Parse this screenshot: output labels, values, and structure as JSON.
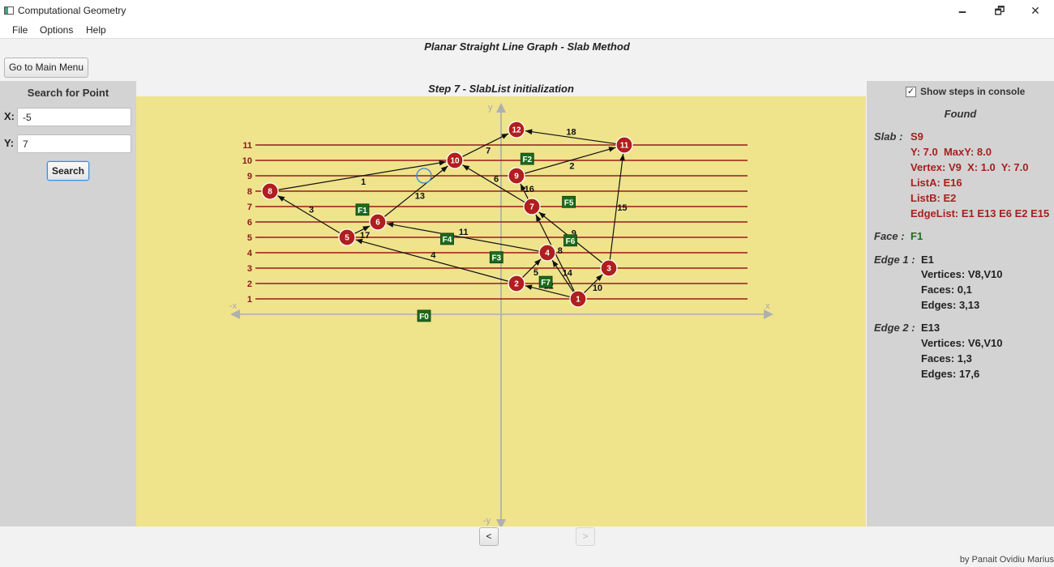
{
  "window": {
    "title": "Computational Geometry",
    "controls": [
      "🗕",
      "🗗",
      "✕"
    ]
  },
  "menu": [
    "File",
    "Options",
    "Help"
  ],
  "main_title": "Planar Straight Line Graph - Slab Method",
  "main_menu_button": "Go to Main Menu",
  "search": {
    "title": "Search for Point",
    "x_label": "X:",
    "x_value": "-5",
    "y_label": "Y:",
    "y_value": "7",
    "button": "Search"
  },
  "step_title": "Step 7 - SlabList initialization",
  "graph": {
    "axis_labels": {
      "x": "x",
      "neg_x": "-x",
      "y": "y",
      "neg_y": "-y"
    },
    "slabs": [
      1,
      2,
      3,
      4,
      5,
      6,
      7,
      8,
      9,
      10,
      11
    ],
    "vertices": [
      {
        "id": "1",
        "x": 5,
        "y": 1
      },
      {
        "id": "2",
        "x": 1,
        "y": 2
      },
      {
        "id": "3",
        "x": 7,
        "y": 3
      },
      {
        "id": "4",
        "x": 3,
        "y": 4
      },
      {
        "id": "5",
        "x": -10,
        "y": 5
      },
      {
        "id": "6",
        "x": -8,
        "y": 6
      },
      {
        "id": "7",
        "x": 2,
        "y": 7
      },
      {
        "id": "8",
        "x": -15,
        "y": 8
      },
      {
        "id": "9",
        "x": 1,
        "y": 9
      },
      {
        "id": "10",
        "x": -3,
        "y": 10
      },
      {
        "id": "11",
        "x": 8,
        "y": 11
      },
      {
        "id": "12",
        "x": 1,
        "y": 12
      }
    ],
    "edges": [
      {
        "label": "1",
        "from": "8",
        "to": "10"
      },
      {
        "label": "2",
        "from": "9",
        "to": "11"
      },
      {
        "label": "3",
        "from": "5",
        "to": "8"
      },
      {
        "label": "4",
        "from": "2",
        "to": "5"
      },
      {
        "label": "5",
        "from": "2",
        "to": "4"
      },
      {
        "label": "6",
        "from": "7",
        "to": "10"
      },
      {
        "label": "7",
        "from": "10",
        "to": "12"
      },
      {
        "label": "8",
        "from": "1",
        "to": "7"
      },
      {
        "label": "9",
        "from": "3",
        "to": "7"
      },
      {
        "label": "10",
        "from": "1",
        "to": "3"
      },
      {
        "label": "11",
        "from": "4",
        "to": "6"
      },
      {
        "label": "12",
        "from": "1",
        "to": "2"
      },
      {
        "label": "13",
        "from": "6",
        "to": "10"
      },
      {
        "label": "14",
        "from": "1",
        "to": "4"
      },
      {
        "label": "15",
        "from": "3",
        "to": "11"
      },
      {
        "label": "16",
        "from": "7",
        "to": "9"
      },
      {
        "label": "17",
        "from": "5",
        "to": "6"
      },
      {
        "label": "18",
        "from": "11",
        "to": "12"
      }
    ],
    "faces": [
      {
        "id": "F0",
        "x": -5,
        "y": -0.1
      },
      {
        "id": "F1",
        "x": -9,
        "y": 6.8
      },
      {
        "id": "F2",
        "x": 1.7,
        "y": 10.1
      },
      {
        "id": "F3",
        "x": -0.3,
        "y": 3.7
      },
      {
        "id": "F4",
        "x": -3.5,
        "y": 4.9
      },
      {
        "id": "F5",
        "x": 4.4,
        "y": 7.3
      },
      {
        "id": "F6",
        "x": 4.5,
        "y": 4.8
      },
      {
        "id": "F7",
        "x": 2.9,
        "y": 2.1
      }
    ],
    "search_point": {
      "x": -5,
      "y": 9
    }
  },
  "panel": {
    "show_steps_label": "Show steps in console",
    "show_steps_checked": true,
    "found_title": "Found",
    "slab_label": "Slab :",
    "slab_lines": [
      "S9",
      "Y: 7.0  MaxY: 8.0",
      "Vertex: V9  X: 1.0  Y: 7.0",
      "ListA: E16",
      "ListB: E2",
      "EdgeList: E1 E13 E6 E2 E15"
    ],
    "face_label": "Face :",
    "face_value": "F1",
    "edge1_label": "Edge 1 :",
    "edge1_lines": [
      "E1",
      "Vertices: V8,V10",
      "Faces: 0,1",
      "Edges: 3,13"
    ],
    "edge2_label": "Edge 2 :",
    "edge2_lines": [
      "E13",
      "Vertices: V6,V10",
      "Faces: 1,3",
      "Edges: 17,6"
    ]
  },
  "nav": {
    "prev": "<",
    "next": ">"
  },
  "author": "by Panait Ovidiu Marius",
  "colors": {
    "canvas": "#efe38c",
    "vertex": "#b01e1e",
    "slab_line": "#9b1b1b",
    "face_box": "#1c6b1c",
    "panel_red": "#a81f1f"
  }
}
